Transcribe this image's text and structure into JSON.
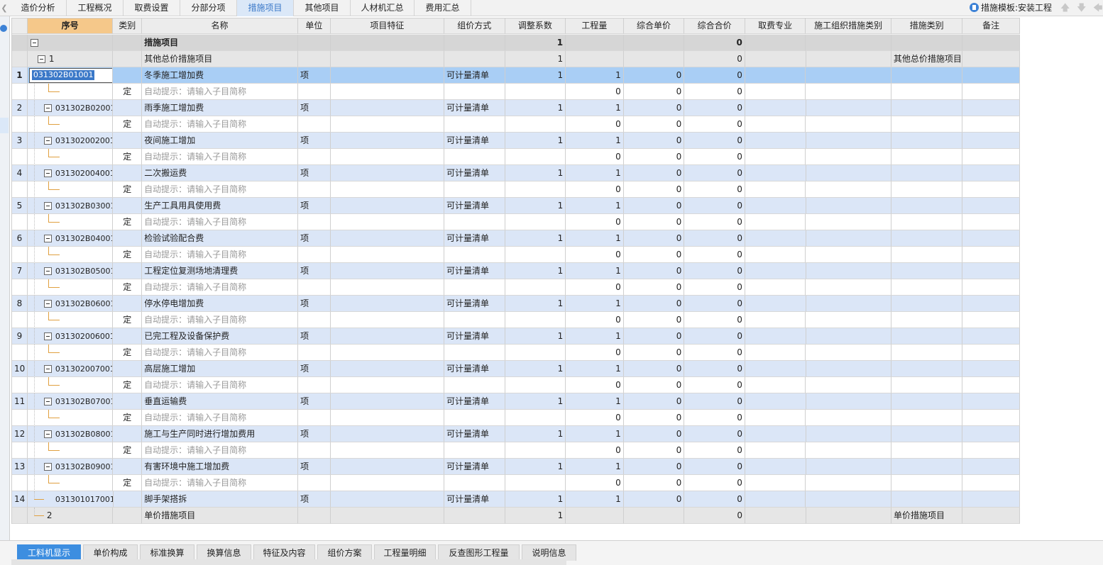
{
  "top_tabs": [
    "造价分析",
    "工程概况",
    "取费设置",
    "分部分项",
    "措施项目",
    "其他项目",
    "人材机汇总",
    "费用汇总"
  ],
  "active_top_tab": "措施项目",
  "template_label": "措施模板:安装工程",
  "columns": [
    "序号",
    "类别",
    "名称",
    "单位",
    "项目特征",
    "组价方式",
    "调整系数",
    "工程量",
    "综合单价",
    "综合合价",
    "取费专业",
    "施工组织措施类别",
    "措施类别",
    "备注"
  ],
  "summary_row": {
    "name": "措施项目",
    "coef": "1",
    "total": "0"
  },
  "group1": {
    "seq": "1",
    "name": "其他总价措施项目",
    "coef": "1",
    "total": "0",
    "category": "其他总价措施项目"
  },
  "edit_code": "031302B01001",
  "items": [
    {
      "num": "1",
      "code": "031302B01001",
      "name": "冬季施工增加费"
    },
    {
      "num": "2",
      "code": "031302B02001",
      "name": "雨季施工增加费"
    },
    {
      "num": "3",
      "code": "031302002001",
      "name": "夜间施工增加"
    },
    {
      "num": "4",
      "code": "031302004001",
      "name": "二次搬运费"
    },
    {
      "num": "5",
      "code": "031302B03001",
      "name": "生产工具用具使用费"
    },
    {
      "num": "6",
      "code": "031302B04001",
      "name": "检验试验配合费"
    },
    {
      "num": "7",
      "code": "031302B05001",
      "name": "工程定位复测场地清理费"
    },
    {
      "num": "8",
      "code": "031302B06001",
      "name": "停水停电增加费"
    },
    {
      "num": "9",
      "code": "031302006001",
      "name": "已完工程及设备保护费"
    },
    {
      "num": "10",
      "code": "031302007001",
      "name": "高层施工增加"
    },
    {
      "num": "11",
      "code": "031302B07001",
      "name": "垂直运输费"
    },
    {
      "num": "12",
      "code": "031302B08001",
      "name": "施工与生产同时进行增加费用"
    },
    {
      "num": "13",
      "code": "031302B09001",
      "name": "有害环境中施工增加费"
    }
  ],
  "item14": {
    "num": "14",
    "code": "031301017001",
    "name": "脚手架搭拆"
  },
  "item_defaults": {
    "unit": "项",
    "method": "可计量清单",
    "coef": "1",
    "qty": "1",
    "unit_price": "0",
    "total": "0"
  },
  "sub_defaults": {
    "type": "定",
    "hint": "自动提示：请输入子目简称",
    "qty": "0",
    "unit_price": "0",
    "total": "0"
  },
  "group2": {
    "seq": "2",
    "name": "单价措施项目",
    "coef": "1",
    "total": "0",
    "category": "单价措施项目"
  },
  "bottom_tabs": [
    "工料机显示",
    "单价构成",
    "标准换算",
    "换算信息",
    "特征及内容",
    "组价方案",
    "工程量明细",
    "反查图形工程量",
    "说明信息"
  ],
  "active_bottom_tab": "工料机显示",
  "colors": {
    "selected_row": "#a9cef5",
    "item_row": "#dbe6f7",
    "tree_line": "#e0a040",
    "active_tab": "#3d8ee0"
  },
  "icons": {
    "template": "document-icon",
    "up": "arrow-up-icon",
    "down": "arrow-down-icon",
    "left": "arrow-left-icon",
    "expand": "collapse-box-icon"
  }
}
